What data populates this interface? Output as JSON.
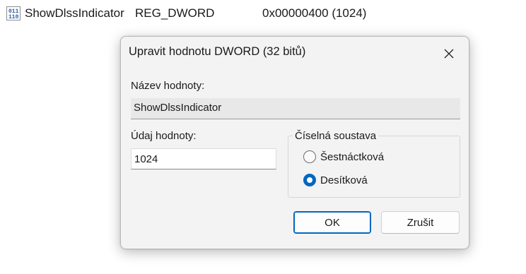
{
  "registry_row": {
    "icon": "registry-binary-icon",
    "name": "ShowDlssIndicator",
    "type": "REG_DWORD",
    "data": "0x00000400 (1024)"
  },
  "dialog": {
    "title": "Upravit hodnotu DWORD (32 bitů)",
    "close_icon": "close-icon",
    "value_name_label": "Název hodnoty:",
    "value_name": "ShowDlssIndicator",
    "value_data_label": "Údaj hodnoty:",
    "value_data": "1024",
    "radix": {
      "legend": "Číselná soustava",
      "options": [
        {
          "label": "Šestnáctková",
          "selected": false
        },
        {
          "label": "Desítková",
          "selected": true
        }
      ]
    },
    "ok_label": "OK",
    "cancel_label": "Zrušit"
  },
  "colors": {
    "accent": "#0067c0",
    "dialog_bg": "#f3f3f3"
  }
}
